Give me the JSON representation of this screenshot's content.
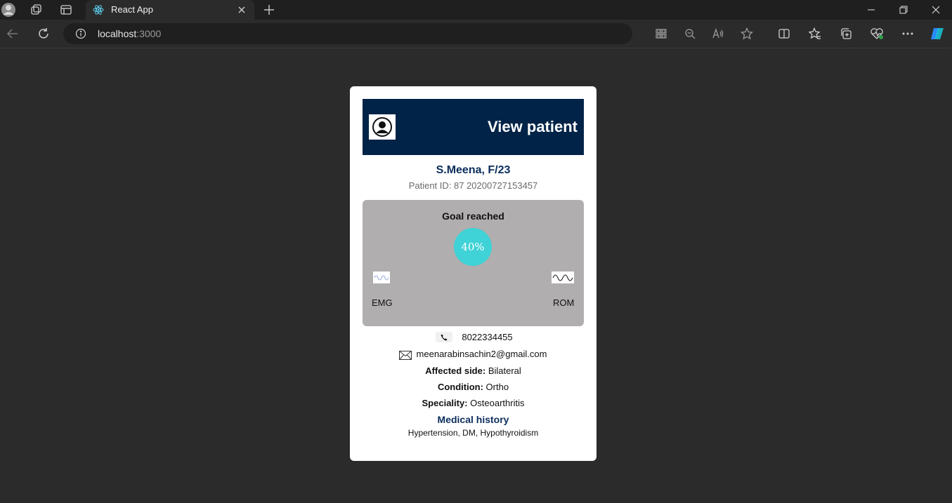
{
  "browser": {
    "tab_title": "React App",
    "url_host": "localhost",
    "url_port": ":3000"
  },
  "card": {
    "header_title": "View patient",
    "patient_name": "S.Meena, F/23",
    "patient_id": "Patient ID: 87 20200727153457",
    "goal": {
      "title": "Goal reached",
      "percent_label": "40%",
      "percent": 40
    },
    "graphs": [
      {
        "label": "EMG"
      },
      {
        "label": "ROM"
      }
    ],
    "phone": "8022334455",
    "email": "meenarabinsachin2@gmail.com",
    "affected_side": {
      "label": "Affected side:",
      "value": "Bilateral"
    },
    "condition": {
      "label": "Condition:",
      "value": "Ortho"
    },
    "speciality": {
      "label": "Speciality:",
      "value": "Osteoarthritis"
    },
    "medical_history": {
      "title": "Medical history",
      "text": "Hypertension, DM, Hypothyroidism"
    }
  },
  "colors": {
    "header_bg": "#002347",
    "accent_circle": "#3fd2d6",
    "panel_bg": "#b0aeaf",
    "page_bg": "#2b2b2b"
  }
}
